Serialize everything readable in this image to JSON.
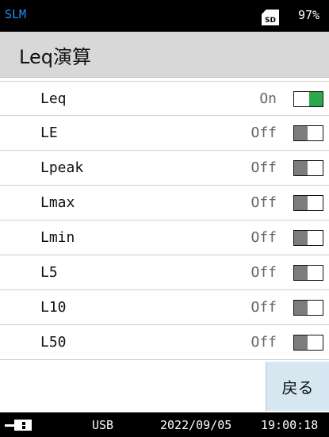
{
  "status_bar": {
    "app_tag": "SLM",
    "sd_label": "SD",
    "battery": "97%"
  },
  "title": "Leq演算",
  "colors": {
    "on": "#2aa84a",
    "off": "#7c7c7c",
    "accent": "#1e90ff",
    "back_button_bg": "#d6e7f2"
  },
  "items": [
    {
      "label": "Leq",
      "value": "On",
      "on": true
    },
    {
      "label": "LE",
      "value": "Off",
      "on": false
    },
    {
      "label": "Lpeak",
      "value": "Off",
      "on": false
    },
    {
      "label": "Lmax",
      "value": "Off",
      "on": false
    },
    {
      "label": "Lmin",
      "value": "Off",
      "on": false
    },
    {
      "label": "L5",
      "value": "Off",
      "on": false
    },
    {
      "label": "L10",
      "value": "Off",
      "on": false
    },
    {
      "label": "L50",
      "value": "Off",
      "on": false
    }
  ],
  "back_button": "戻る",
  "footer": {
    "icon": "connector-icon",
    "usb": "USB",
    "date": "2022/09/05",
    "time": "19:00:18"
  }
}
